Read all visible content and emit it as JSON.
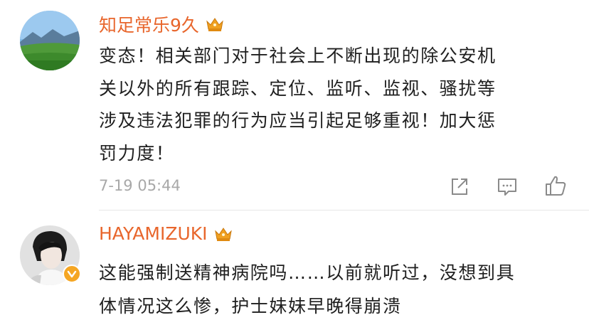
{
  "comments": [
    {
      "username": "知足常乐9久",
      "content_lines": [
        "变态！相关部门对于社会上不断出现的除公安机",
        "关以外的所有跟踪、定位、监听、监视、骚扰等",
        "涉及违法犯罪的行为应当引起足够重视！加大惩",
        "罚力度！"
      ],
      "time": "7-19 05:44",
      "icons": {
        "crown": "crown-icon",
        "share": "share-icon",
        "comment": "comment-icon",
        "like": "like-icon"
      }
    },
    {
      "username": "HAYAMIZUKI",
      "content_lines": [
        "这能强制送精神病院吗……以前就听过，没想到具",
        "体情况这么惨，护士妹妹早晚得崩溃"
      ],
      "icons": {
        "crown": "crown-icon",
        "verified": "verified-badge-icon"
      }
    }
  ],
  "colors": {
    "username": "#e8662c",
    "text": "#1f1f1f",
    "meta": "#a8a8a8",
    "crown": "#f0a020"
  }
}
